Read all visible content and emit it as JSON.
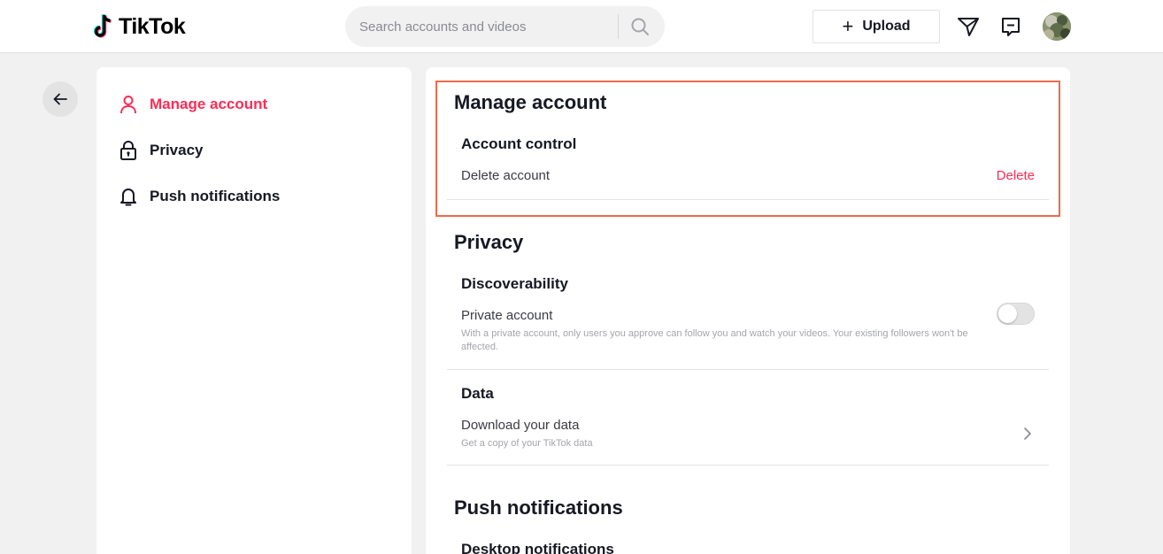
{
  "header": {
    "logo_text": "TikTok",
    "search_placeholder": "Search accounts and videos",
    "upload_label": "Upload",
    "icons": [
      "tiktok-logo-icon",
      "search-icon",
      "plus-icon",
      "send-icon",
      "message-icon",
      "avatar"
    ]
  },
  "sidebar": {
    "items": [
      {
        "label": "Manage account",
        "icon": "user-icon",
        "active": true
      },
      {
        "label": "Privacy",
        "icon": "lock-icon",
        "active": false
      },
      {
        "label": "Push notifications",
        "icon": "bell-icon",
        "active": false
      }
    ]
  },
  "main": {
    "manage": {
      "title": "Manage account",
      "account_control": "Account control",
      "delete_account": "Delete account",
      "delete_link": "Delete"
    },
    "privacy": {
      "title": "Privacy",
      "discoverability": "Discoverability",
      "private_account": "Private account",
      "private_desc": "With a private account, only users you approve can follow you and watch your videos. Your existing followers won't be affected.",
      "private_enabled": false,
      "data": "Data",
      "download_data": "Download your data",
      "download_desc": "Get a copy of your TikTok data"
    },
    "push": {
      "title": "Push notifications",
      "desktop": "Desktop notifications"
    }
  },
  "colors": {
    "accent": "#fe2c55",
    "highlight_border": "#ee6a4c",
    "background": "#f1f1f2"
  }
}
